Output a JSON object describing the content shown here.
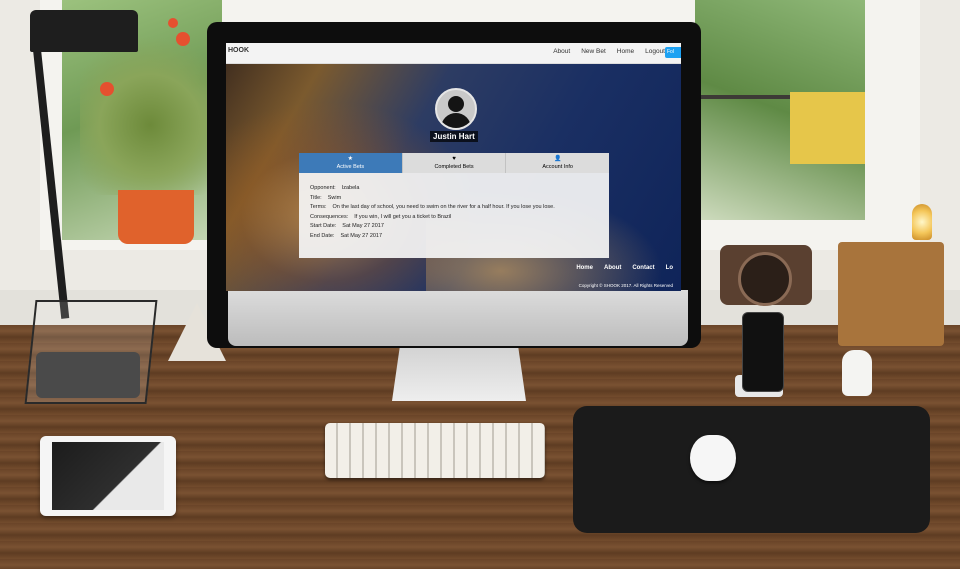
{
  "site": {
    "brand": "HOOK",
    "nav": [
      "About",
      "New Bet",
      "Home",
      "Logout"
    ],
    "twitter_label": "Fol"
  },
  "profile": {
    "name": "Justin Hart"
  },
  "tabs": [
    {
      "label": "Active Bets",
      "icon": "star-icon",
      "glyph": "★",
      "active": true
    },
    {
      "label": "Completed Bets",
      "icon": "heart-icon",
      "glyph": "♥",
      "active": false
    },
    {
      "label": "Account Info",
      "icon": "user-icon",
      "glyph": "👤",
      "active": false
    }
  ],
  "bet": {
    "opponent_key": "Opponent:",
    "opponent": "Izabela",
    "title_key": "Title:",
    "title": "Swim",
    "terms_key": "Terms:",
    "terms": "On the last day of school, you need to swim on the river for a half hour. If you lose you lose.",
    "consequences_key": "Consequences:",
    "consequences": "If you win, I will get you a ticket to Brazil",
    "start_key": "Start Date:",
    "start": "Sat May 27 2017",
    "end_key": "End Date:",
    "end": "Sat May 27 2017"
  },
  "footer": {
    "links": [
      "Home",
      "About",
      "Contact",
      "Lo"
    ],
    "copyright": "Copyright © SHOOK 2017. All Rights Reserved"
  },
  "colors": {
    "active_tab": "#3d7ab8",
    "twitter": "#1da1f2",
    "navbar": "#f3f3f3"
  }
}
